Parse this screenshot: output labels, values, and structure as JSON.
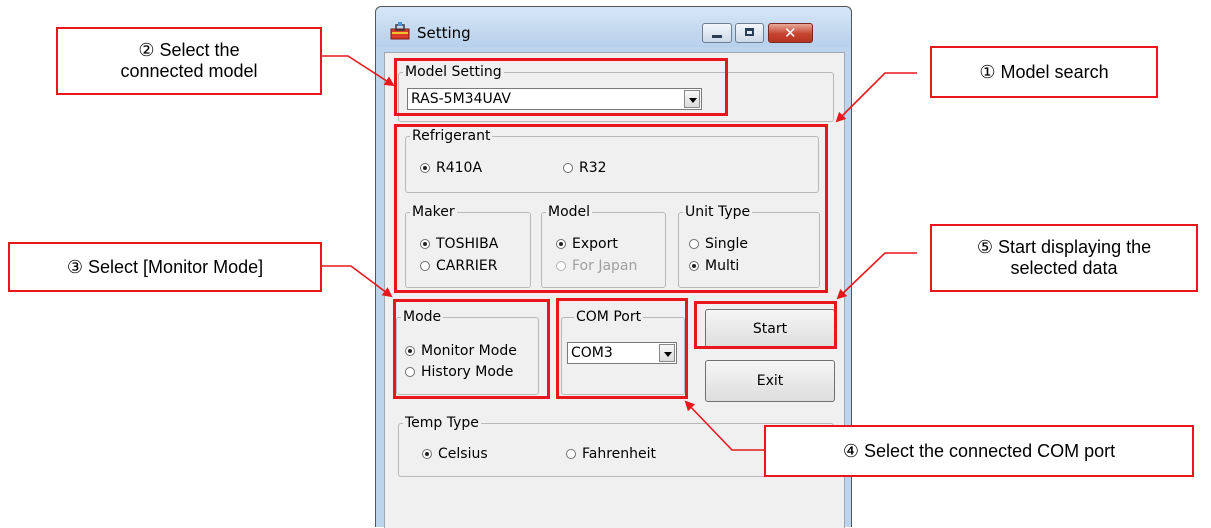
{
  "window": {
    "title": "Setting",
    "icon": "toolbox-icon"
  },
  "model_setting": {
    "legend": "Model Setting",
    "selected_model": "RAS-5M34UAV"
  },
  "refrigerant": {
    "legend": "Refrigerant",
    "options": [
      "R410A",
      "R32"
    ],
    "selected": "R410A"
  },
  "maker": {
    "legend": "Maker",
    "options": [
      "TOSHIBA",
      "CARRIER"
    ],
    "selected": "TOSHIBA"
  },
  "model": {
    "legend": "Model",
    "options": [
      "Export",
      "For Japan"
    ],
    "selected": "Export",
    "disabled": [
      "For Japan"
    ]
  },
  "unit_type": {
    "legend": "Unit Type",
    "options": [
      "Single",
      "Multi"
    ],
    "selected": "Multi"
  },
  "mode": {
    "legend": "Mode",
    "options": [
      "Monitor Mode",
      "History Mode"
    ],
    "selected": "Monitor Mode"
  },
  "com_port": {
    "legend": "COM Port",
    "selected": "COM3"
  },
  "buttons": {
    "start": "Start",
    "exit": "Exit"
  },
  "temp_type": {
    "legend": "Temp Type",
    "options": [
      "Celsius",
      "Fahrenheit"
    ],
    "selected": "Celsius"
  },
  "annotations": {
    "select_model": "② Select the connected model",
    "select_model_line1": "② Select the",
    "select_model_line2": "connected model",
    "model_search": "① Model search",
    "select_mode": "③ Select [Monitor Mode]",
    "start_display_line1": "⑤ Start displaying the",
    "start_display_line2": "selected data",
    "select_com": "④ Select the connected COM port"
  },
  "colors": {
    "annotation_red": "#e8171c",
    "window_frame": "#bcd4ec",
    "client_bg": "#f0f0f0"
  }
}
